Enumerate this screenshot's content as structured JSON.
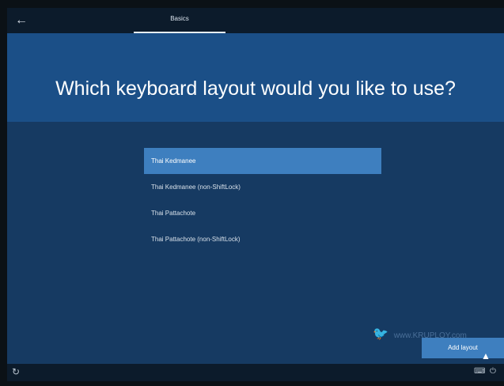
{
  "nav": {
    "back_icon": "arrow-left-icon",
    "tab_label": "Basics"
  },
  "title": "Which keyboard layout would you like to use?",
  "layouts": [
    {
      "label": "Thai Kedmanee",
      "selected": true
    },
    {
      "label": "Thai Kedmanee (non-ShiftLock)",
      "selected": false
    },
    {
      "label": "Thai Pattachote",
      "selected": false
    },
    {
      "label": "Thai Pattachote (non-ShiftLock)",
      "selected": false
    }
  ],
  "watermark": {
    "text": "www.KRUPLOY.com",
    "logo_icon": "bird-logo-icon"
  },
  "actions": {
    "add_layout_label": "Add layout"
  },
  "bottombar": {
    "left_icon": "ease-of-access-icon",
    "right_icons": [
      "keyboard-icon",
      "power-icon"
    ]
  },
  "colors": {
    "background": "#163a62",
    "header_band": "#1b4f87",
    "accent": "#3e7fbf",
    "topbar": "#0c1b2b"
  }
}
